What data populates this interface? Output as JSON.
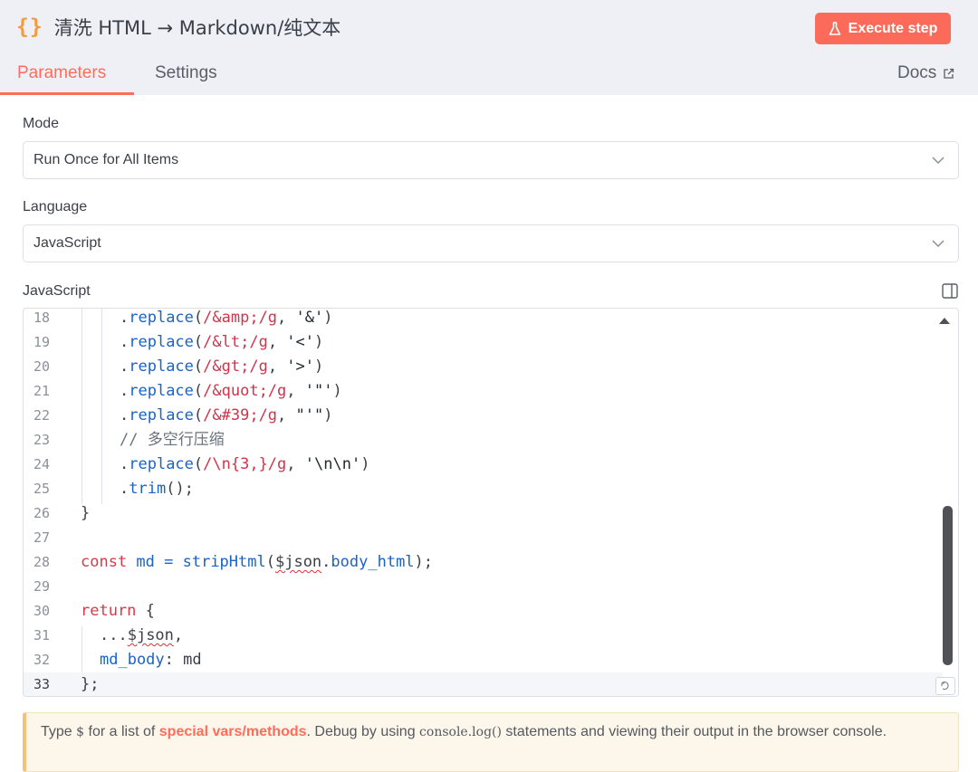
{
  "header": {
    "braces": "{}",
    "title": "清洗 HTML → Markdown/纯文本",
    "execute_label": "Execute step"
  },
  "tabs": {
    "parameters": "Parameters",
    "settings": "Settings",
    "docs": "Docs"
  },
  "form": {
    "mode_label": "Mode",
    "mode_value": "Run Once for All Items",
    "language_label": "Language",
    "language_value": "JavaScript",
    "code_label": "JavaScript"
  },
  "code_lines": [
    {
      "n": "18"
    },
    {
      "n": "19"
    },
    {
      "n": "20"
    },
    {
      "n": "21"
    },
    {
      "n": "22"
    },
    {
      "n": "23"
    },
    {
      "n": "24"
    },
    {
      "n": "25"
    },
    {
      "n": "26"
    },
    {
      "n": "27"
    },
    {
      "n": "28"
    },
    {
      "n": "29"
    },
    {
      "n": "30"
    },
    {
      "n": "31"
    },
    {
      "n": "32"
    },
    {
      "n": "33"
    }
  ],
  "code": {
    "l18": [
      ".",
      "replace",
      "(",
      "/&amp;/g",
      ", ",
      "'&'",
      ")"
    ],
    "l19": [
      ".",
      "replace",
      "(",
      "/&lt;/g",
      ", ",
      "'<'",
      ")"
    ],
    "l20": [
      ".",
      "replace",
      "(",
      "/&gt;/g",
      ", ",
      "'>'",
      ")"
    ],
    "l21": [
      ".",
      "replace",
      "(",
      "/&quot;/g",
      ", ",
      "'\"'",
      ")"
    ],
    "l22": [
      ".",
      "replace",
      "(",
      "/&#39;/g",
      ", ",
      "\"'\"",
      ")"
    ],
    "l23": "// 多空行压缩",
    "l24": [
      ".",
      "replace",
      "(",
      "/\\n{3,}/g",
      ", ",
      "'\\n\\n'",
      ")"
    ],
    "l25": [
      ".",
      "trim",
      "();"
    ],
    "l26": "}",
    "l28": [
      "const",
      " md = ",
      "stripHtml",
      "(",
      "$json",
      ".",
      "body_html",
      ");"
    ],
    "l30": [
      "return",
      " {"
    ],
    "l31": [
      "...",
      "$json",
      ","
    ],
    "l32": [
      "md_body",
      ": md"
    ],
    "l33": "};"
  },
  "notice": {
    "part1": "Type ",
    "dollar": "$",
    "part2": " for a list of ",
    "link": "special vars/methods",
    "part3": ". Debug by using ",
    "code1": "console.log()",
    "part4": " statements and viewing their output in the browser console."
  },
  "colors": {
    "accent": "#ff6d5a",
    "execute_bg": "#fc6b59",
    "braces": "#f59b3a"
  },
  "icons": [
    "braces-icon",
    "flask-icon",
    "external-link-icon",
    "chevron-down-icon",
    "split-panel-icon",
    "scroll-up-arrow-icon",
    "resize-icon"
  ]
}
